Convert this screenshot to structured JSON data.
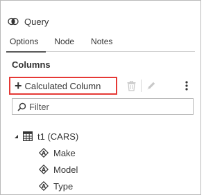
{
  "header": {
    "title": "Query",
    "icon": "venn-icon"
  },
  "tabs": [
    {
      "label": "Options",
      "active": true
    },
    {
      "label": "Node",
      "active": false
    },
    {
      "label": "Notes",
      "active": false
    }
  ],
  "section": {
    "title": "Columns"
  },
  "toolbar": {
    "calculated_column_label": "Calculated Column",
    "highlight_color": "#e53935"
  },
  "filter": {
    "placeholder": "Filter",
    "value": ""
  },
  "tree": {
    "table": {
      "label": "t1 (CARS)",
      "expanded": true
    },
    "columns": [
      {
        "label": "Make"
      },
      {
        "label": "Model"
      },
      {
        "label": "Type"
      }
    ]
  }
}
